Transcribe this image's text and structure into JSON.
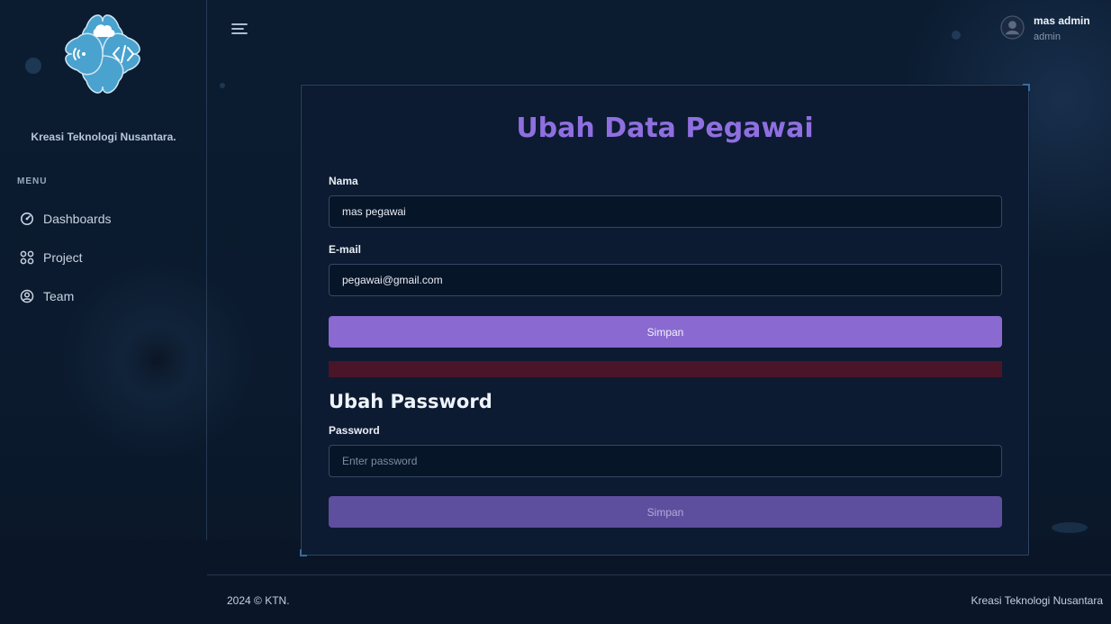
{
  "sidebar": {
    "brand": "Kreasi Teknologi Nusantara.",
    "menu_label": "MENU",
    "items": [
      {
        "label": "Dashboards",
        "icon": "gauge-icon"
      },
      {
        "label": "Project",
        "icon": "grid-icon"
      },
      {
        "label": "Team",
        "icon": "user-circle-icon"
      }
    ]
  },
  "header": {
    "user_name": "mas admin",
    "user_role": "admin"
  },
  "form": {
    "title": "Ubah Data Pegawai",
    "name_label": "Nama",
    "name_value": "mas pegawai",
    "email_label": "E-mail",
    "email_value": "pegawai@gmail.com",
    "save_label": "Simpan"
  },
  "password": {
    "title": "Ubah Password",
    "label": "Password",
    "placeholder": "Enter password",
    "save_label": "Simpan"
  },
  "footer": {
    "copyright": "2024 © KTN.",
    "company": "Kreasi Teknologi Nusantara"
  },
  "colors": {
    "accent": "#8a6ad0",
    "title": "#8f6fe0",
    "background": "#0b1c31",
    "danger": "#4a1528"
  }
}
